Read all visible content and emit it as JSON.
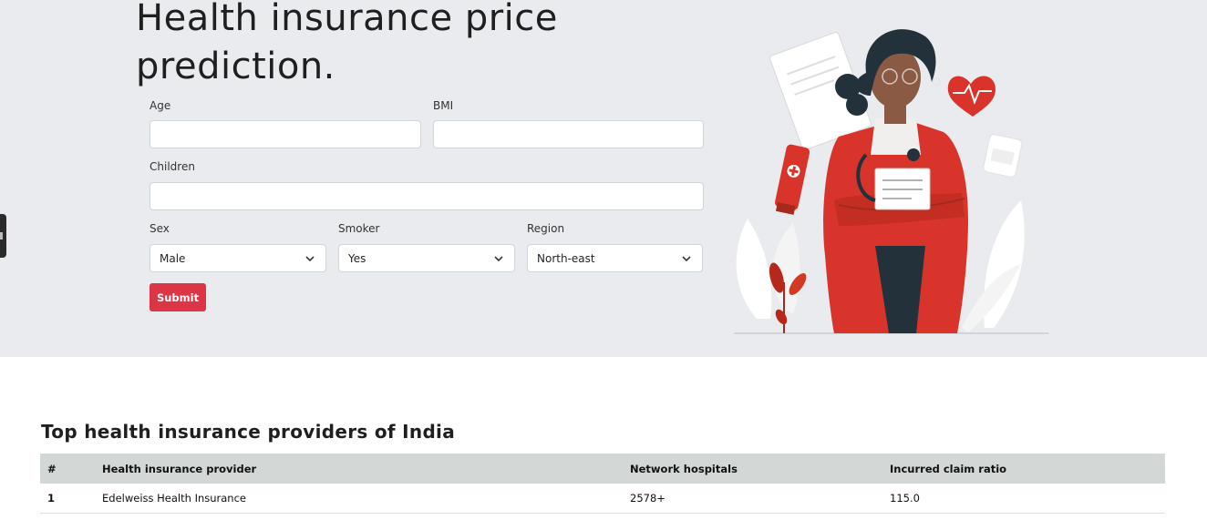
{
  "header": {
    "title": "Health insurance price prediction."
  },
  "form": {
    "age_label": "Age",
    "age_value": "",
    "bmi_label": "BMI",
    "bmi_value": "",
    "children_label": "Children",
    "children_value": "",
    "sex_label": "Sex",
    "sex_value": "Male",
    "smoker_label": "Smoker",
    "smoker_value": "Yes",
    "region_label": "Region",
    "region_value": "North-east",
    "submit_label": "Submit"
  },
  "colors": {
    "hero_bg": "#e9ebee",
    "accent": "#dc3545",
    "table_header_bg": "#d3d8d7"
  },
  "illustration": {
    "icon": "doctor-illustration"
  },
  "providers": {
    "title": "Top health insurance providers of India",
    "columns": [
      "#",
      "Health insurance provider",
      "Network hospitals",
      "Incurred claim ratio"
    ],
    "rows": [
      {
        "rank": "1",
        "provider": "Edelweiss Health Insurance",
        "hospitals": "2578+",
        "ratio": "115.0"
      }
    ]
  }
}
